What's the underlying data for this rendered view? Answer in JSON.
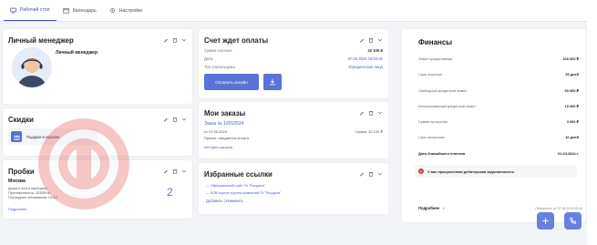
{
  "tabs": [
    {
      "label": "Рабочий стол",
      "icon": "desktop-icon"
    },
    {
      "label": "Календарь",
      "icon": "calendar-icon"
    },
    {
      "label": "Настройки",
      "icon": "gear-icon"
    }
  ],
  "manager": {
    "title": "Личный менеджер",
    "name": "Личный менеджер"
  },
  "discounts": {
    "title": "Скидки",
    "item": "Подарки в корзине"
  },
  "traffic": {
    "title": "Пробки",
    "city": "Москва",
    "lines": [
      "Дороги почти свободны",
      "Протяженность: 323/59 м",
      "Последнее обновление 14:53"
    ],
    "more": "Подробнее",
    "score": "2"
  },
  "invoice": {
    "title": "Счет ждет оплаты",
    "rows": [
      {
        "label": "Сумма платежа",
        "value": "32 100 ₽"
      },
      {
        "label": "Дата",
        "value": "07.05.2024 10:04:00"
      },
      {
        "label": "Тип плательщика",
        "value": "Юридическое лицо"
      }
    ],
    "pay_button": "Оплатить онлайн"
  },
  "orders": {
    "title": "Мои заказы",
    "order_link": "Заказ № 1/05/2024",
    "order_date": "от 07.05.2024",
    "order_status": "Принят, ожидается оплата",
    "order_sum": "Сумма: 32 100 ₽",
    "history": "История заказов"
  },
  "favorites": {
    "title": "Избранные ссылки",
    "links": [
      "→ Официальный сайт ГК \"Росдача\"",
      "→ B2B портал группы компаний ГК \"Росдача\""
    ],
    "actions": "Добавить | Изменить"
  },
  "finance": {
    "title": "Финансы",
    "rows": [
      {
        "label": "Лимит кредитования",
        "value": "100 000 ₽"
      },
      {
        "label": "Срок отсрочки",
        "value": "25 дней"
      },
      {
        "label": "Свободный кредитный лимит",
        "value": "50 000 ₽"
      },
      {
        "label": "Использованный кредитный лимит",
        "value": "10 000 ₽"
      },
      {
        "label": "Сумма просрочки",
        "value": "3 000 ₽"
      },
      {
        "label": "Срок просрочки",
        "value": "10 дней"
      },
      {
        "label": "Дата ближайшего платежа",
        "value": "01.04.2024 г."
      }
    ],
    "alert": "У вас просроченная дебиторская задолженность",
    "more": "Подробнее",
    "updated": "Обновлено: от 27.04.2024 09:44"
  },
  "colors": {
    "accent": "#5c72d6",
    "alert": "#d63c3c"
  }
}
